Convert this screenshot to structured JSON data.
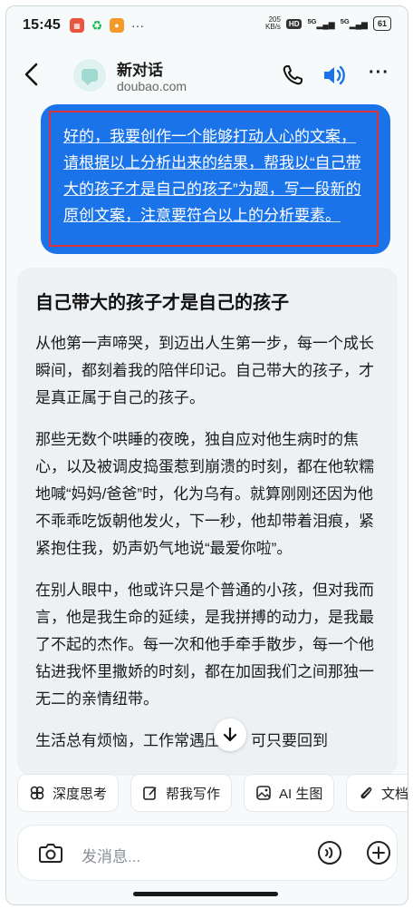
{
  "status_bar": {
    "time": "15:45",
    "app_badges": [
      "red-app-icon",
      "green-app-icon",
      "orange-app-icon"
    ],
    "more": "···",
    "net_speed_value": "205",
    "net_speed_unit": "KB/s",
    "hd": "HD",
    "signal1": "5G",
    "signal2": "5G",
    "battery": "61"
  },
  "header": {
    "back_icon": "back-arrow-icon",
    "title": "新对话",
    "subtitle": "doubao.com",
    "call_icon": "phone-icon",
    "speaker_icon": "speaker-icon",
    "more_label": "···"
  },
  "chat": {
    "user_message": "好的，我要创作一个能够打动人心的文案，请根据以上分析出来的结果，帮我以“自己带大的孩子才是自己的孩子”为题，写一段新的原创文案，注意要符合以上的分析要素。",
    "ai_title": "自己带大的孩子才是自己的孩子",
    "ai_paragraphs": [
      "从他第一声啼哭，到迈出人生第一步，每一个成长瞬间，都刻着我的陪伴印记。自己带大的孩子，才是真正属于自己的孩子。",
      "那些无数个哄睡的夜晚，独自应对他生病时的焦心，以及被调皮捣蛋惹到崩溃的时刻，都在他软糯地喊“妈妈/爸爸”时，化为乌有。就算刚刚还因为他不乖乖吃饭朝他发火，下一秒，他却带着泪痕，紧紧抱住我，奶声奶气地说“最爱你啦”。",
      "在别人眼中，他或许只是个普通的小孩，但对我而言，他是我生命的延续，是我拼搏的动力，是我最了不起的杰作。每一次和他手牵手散步，每一个他钻进我怀里撒娇的时刻，都在加固我们之间那独一无二的亲情纽带。",
      "生活总有烦恼，工作常遇压力，可只要回到"
    ]
  },
  "chips": [
    {
      "label": "深度思考",
      "icon": "deep-think-icon"
    },
    {
      "label": "帮我写作",
      "icon": "write-icon"
    },
    {
      "label": "AI 生图",
      "icon": "image-icon"
    },
    {
      "label": "文档",
      "icon": "paperclip-icon"
    }
  ],
  "input": {
    "placeholder": "发消息...",
    "camera_icon": "camera-icon",
    "voice_icon": "voice-icon",
    "plus_icon": "plus-icon"
  },
  "colors": {
    "accent": "#1a73e8",
    "highlight_border": "#d9323a",
    "card_bg": "#eef1f4"
  }
}
